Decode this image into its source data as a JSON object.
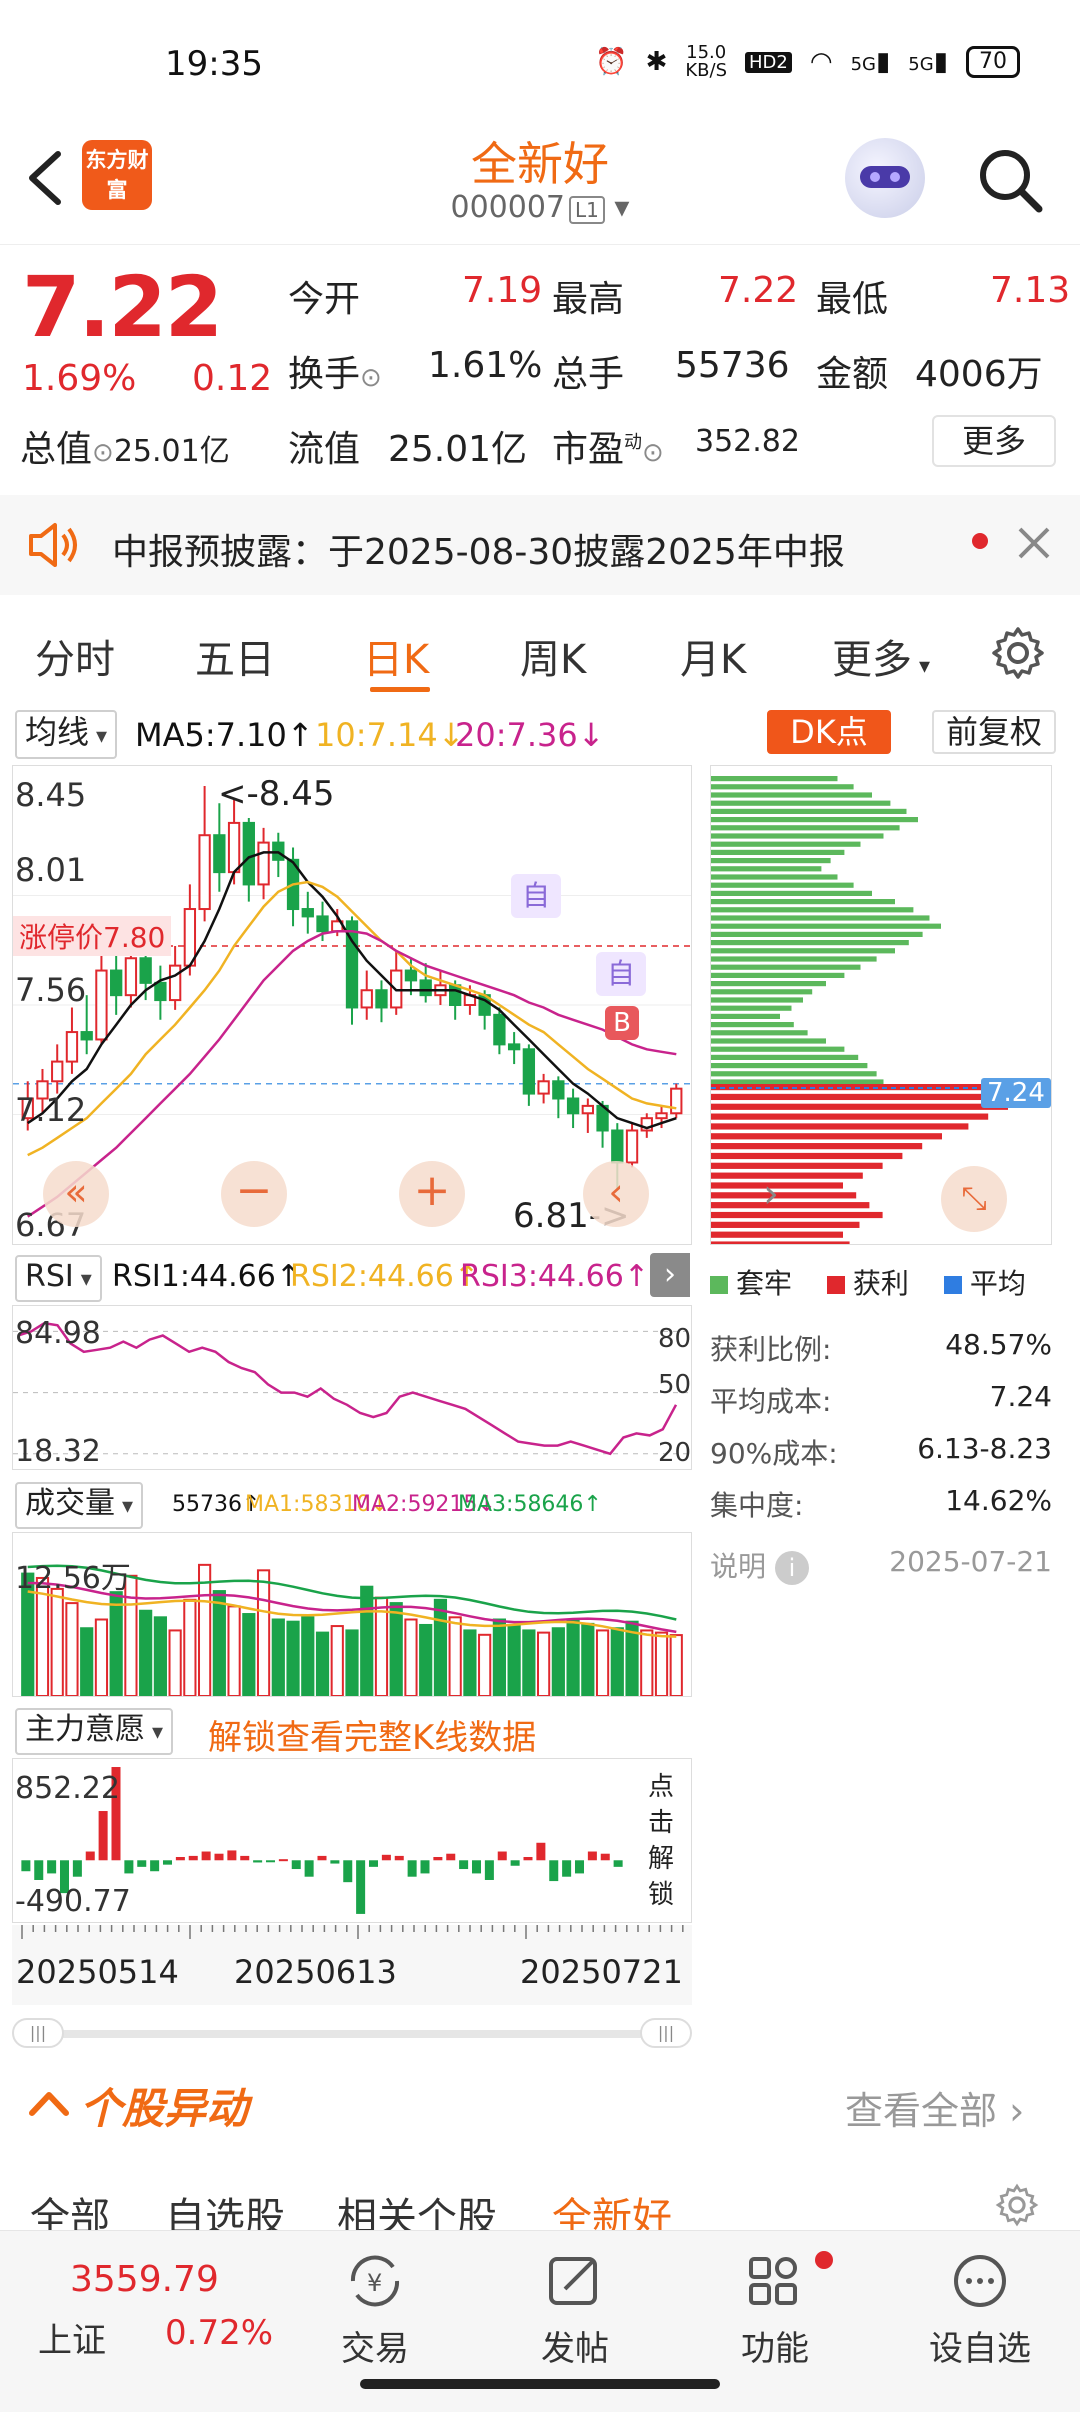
{
  "status": {
    "time": "19:35",
    "net_speed": "15.0",
    "net_unit": "KB/S",
    "hd": "HD2",
    "sig1": "5G",
    "sig2": "5G",
    "battery": "70"
  },
  "header": {
    "logo_text": "东方财富",
    "stock_name": "全新好",
    "stock_code": "000007",
    "level": "L1"
  },
  "quote": {
    "price": "7.22",
    "change_pct": "1.69%",
    "change": "0.12",
    "open_label": "今开",
    "open": "7.19",
    "high_label": "最高",
    "high": "7.22",
    "low_label": "最低",
    "low": "7.13",
    "turnover_label": "换手",
    "turnover": "1.61%",
    "volume_label": "总手",
    "volume": "55736",
    "amount_label": "金额",
    "amount": "4006万",
    "mcap_label": "总值",
    "mcap": "25.01亿",
    "float_label": "流值",
    "float": "25.01亿",
    "pe_label": "市盈",
    "pe_sup": "动",
    "pe": "352.82",
    "more_label": "更多"
  },
  "notice": {
    "text": "中报预披露：于2025-08-30披露2025年中报"
  },
  "tabs": [
    "分时",
    "五日",
    "日K",
    "周K",
    "月K",
    "更多"
  ],
  "active_tab": "日K",
  "ma": {
    "select": "均线",
    "ma5": "MA5:7.10",
    "ma10": "10:7.14",
    "ma20": "20:7.36",
    "dk": "DK点",
    "adjust": "前复权"
  },
  "kline_axis": {
    "y1": "8.45",
    "y2": "8.01",
    "y3": "7.56",
    "y4": "7.12",
    "y5": "6.67",
    "limit_label": "涨停价7.80",
    "high_mark": "<-8.45",
    "low_mark": "6.81->",
    "mark_self": "自",
    "mark_b": "B"
  },
  "chart_data": {
    "type": "candlestick",
    "ylim": [
      6.67,
      8.45
    ],
    "last_label": "7.24",
    "candles": [
      {
        "o": 7.1,
        "c": 7.18,
        "h": 7.25,
        "l": 7.05
      },
      {
        "o": 7.18,
        "c": 7.25,
        "h": 7.3,
        "l": 7.12
      },
      {
        "o": 7.25,
        "c": 7.33,
        "h": 7.4,
        "l": 7.2
      },
      {
        "o": 7.33,
        "c": 7.45,
        "h": 7.55,
        "l": 7.28
      },
      {
        "o": 7.45,
        "c": 7.42,
        "h": 7.6,
        "l": 7.36
      },
      {
        "o": 7.42,
        "c": 7.7,
        "h": 7.82,
        "l": 7.4
      },
      {
        "o": 7.7,
        "c": 7.6,
        "h": 7.8,
        "l": 7.52
      },
      {
        "o": 7.6,
        "c": 7.75,
        "h": 7.85,
        "l": 7.55
      },
      {
        "o": 7.75,
        "c": 7.65,
        "h": 7.82,
        "l": 7.58
      },
      {
        "o": 7.65,
        "c": 7.58,
        "h": 7.72,
        "l": 7.5
      },
      {
        "o": 7.58,
        "c": 7.72,
        "h": 7.8,
        "l": 7.54
      },
      {
        "o": 7.72,
        "c": 7.95,
        "h": 8.05,
        "l": 7.68
      },
      {
        "o": 7.95,
        "c": 8.25,
        "h": 8.45,
        "l": 7.9
      },
      {
        "o": 8.25,
        "c": 8.1,
        "h": 8.38,
        "l": 8.02
      },
      {
        "o": 8.1,
        "c": 8.3,
        "h": 8.4,
        "l": 8.05
      },
      {
        "o": 8.3,
        "c": 8.05,
        "h": 8.32,
        "l": 7.98
      },
      {
        "o": 8.05,
        "c": 8.22,
        "h": 8.28,
        "l": 7.99
      },
      {
        "o": 8.22,
        "c": 8.15,
        "h": 8.26,
        "l": 8.08
      },
      {
        "o": 8.15,
        "c": 7.95,
        "h": 8.2,
        "l": 7.88
      },
      {
        "o": 7.95,
        "c": 7.92,
        "h": 8.02,
        "l": 7.85
      },
      {
        "o": 7.92,
        "c": 7.86,
        "h": 7.98,
        "l": 7.82
      },
      {
        "o": 7.86,
        "c": 7.9,
        "h": 7.95,
        "l": 7.84
      },
      {
        "o": 7.9,
        "c": 7.55,
        "h": 7.92,
        "l": 7.48
      },
      {
        "o": 7.55,
        "c": 7.62,
        "h": 7.7,
        "l": 7.5
      },
      {
        "o": 7.62,
        "c": 7.55,
        "h": 7.66,
        "l": 7.49
      },
      {
        "o": 7.55,
        "c": 7.7,
        "h": 7.78,
        "l": 7.52
      },
      {
        "o": 7.7,
        "c": 7.66,
        "h": 7.75,
        "l": 7.6
      },
      {
        "o": 7.66,
        "c": 7.6,
        "h": 7.73,
        "l": 7.57
      },
      {
        "o": 7.6,
        "c": 7.64,
        "h": 7.7,
        "l": 7.56
      },
      {
        "o": 7.64,
        "c": 7.56,
        "h": 7.66,
        "l": 7.5
      },
      {
        "o": 7.56,
        "c": 7.6,
        "h": 7.64,
        "l": 7.52
      },
      {
        "o": 7.6,
        "c": 7.52,
        "h": 7.62,
        "l": 7.46
      },
      {
        "o": 7.52,
        "c": 7.4,
        "h": 7.55,
        "l": 7.36
      },
      {
        "o": 7.4,
        "c": 7.38,
        "h": 7.45,
        "l": 7.32
      },
      {
        "o": 7.38,
        "c": 7.2,
        "h": 7.4,
        "l": 7.15
      },
      {
        "o": 7.2,
        "c": 7.25,
        "h": 7.28,
        "l": 7.16
      },
      {
        "o": 7.25,
        "c": 7.18,
        "h": 7.27,
        "l": 7.1
      },
      {
        "o": 7.18,
        "c": 7.12,
        "h": 7.22,
        "l": 7.06
      },
      {
        "o": 7.12,
        "c": 7.15,
        "h": 7.18,
        "l": 7.04
      },
      {
        "o": 7.15,
        "c": 7.05,
        "h": 7.17,
        "l": 6.98
      },
      {
        "o": 7.05,
        "c": 6.92,
        "h": 7.08,
        "l": 6.81
      },
      {
        "o": 6.92,
        "c": 7.05,
        "h": 7.08,
        "l": 6.9
      },
      {
        "o": 7.05,
        "c": 7.1,
        "h": 7.12,
        "l": 7.02
      },
      {
        "o": 7.1,
        "c": 7.12,
        "h": 7.15,
        "l": 7.06
      },
      {
        "o": 7.12,
        "c": 7.22,
        "h": 7.24,
        "l": 7.1
      }
    ],
    "ma5": [
      7.08,
      7.12,
      7.18,
      7.25,
      7.3,
      7.4,
      7.48,
      7.56,
      7.62,
      7.66,
      7.68,
      7.72,
      7.82,
      7.95,
      8.1,
      8.16,
      8.18,
      8.18,
      8.14,
      8.06,
      8.0,
      7.92,
      7.82,
      7.74,
      7.68,
      7.62,
      7.62,
      7.62,
      7.62,
      7.62,
      7.6,
      7.58,
      7.54,
      7.48,
      7.42,
      7.36,
      7.3,
      7.24,
      7.2,
      7.15,
      7.1,
      7.08,
      7.06,
      7.08,
      7.1
    ],
    "ma10": [
      6.95,
      6.98,
      7.02,
      7.06,
      7.1,
      7.16,
      7.22,
      7.28,
      7.36,
      7.42,
      7.48,
      7.55,
      7.62,
      7.7,
      7.8,
      7.88,
      7.96,
      8.02,
      8.05,
      8.06,
      8.04,
      8.0,
      7.94,
      7.88,
      7.82,
      7.78,
      7.72,
      7.68,
      7.66,
      7.64,
      7.62,
      7.6,
      7.56,
      7.52,
      7.48,
      7.45,
      7.4,
      7.35,
      7.3,
      7.26,
      7.22,
      7.18,
      7.16,
      7.15,
      7.14
    ],
    "ma20": [
      6.7,
      6.74,
      6.78,
      6.83,
      6.88,
      6.93,
      6.98,
      7.04,
      7.1,
      7.16,
      7.22,
      7.28,
      7.35,
      7.42,
      7.5,
      7.58,
      7.66,
      7.72,
      7.78,
      7.82,
      7.85,
      7.86,
      7.86,
      7.85,
      7.82,
      7.78,
      7.75,
      7.72,
      7.7,
      7.68,
      7.66,
      7.64,
      7.62,
      7.6,
      7.57,
      7.55,
      7.52,
      7.5,
      7.48,
      7.46,
      7.43,
      7.4,
      7.38,
      7.37,
      7.36
    ],
    "rsi_ylim": [
      18.32,
      84.98
    ],
    "rsi": [
      78,
      80,
      84,
      83,
      74,
      70,
      71,
      72,
      75,
      72,
      76,
      78,
      74,
      70,
      72,
      70,
      65,
      62,
      60,
      54,
      50,
      50,
      48,
      52,
      47,
      44,
      40,
      38,
      40,
      48,
      50,
      48,
      46,
      44,
      42,
      38,
      34,
      30,
      26,
      25,
      24,
      24,
      26,
      24,
      22,
      20,
      28,
      30,
      29,
      32,
      44
    ],
    "volume_ylim": [
      0,
      140000
    ],
    "volume": [
      112000,
      108000,
      98000,
      85000,
      62000,
      70000,
      95000,
      110000,
      78000,
      72000,
      60000,
      88000,
      120000,
      96000,
      82000,
      75000,
      115000,
      70000,
      68000,
      72000,
      58000,
      64000,
      60000,
      100000,
      90000,
      85000,
      70000,
      65000,
      88000,
      72000,
      60000,
      56000,
      70000,
      65000,
      60000,
      58000,
      62000,
      70000,
      66000,
      60000,
      62000,
      68000,
      60000,
      58000,
      55736
    ],
    "vol_up": [
      0,
      1,
      1,
      1,
      0,
      1,
      0,
      1,
      0,
      0,
      1,
      1,
      1,
      0,
      1,
      0,
      1,
      0,
      0,
      0,
      0,
      1,
      0,
      0,
      1,
      0,
      1,
      0,
      0,
      1,
      0,
      1,
      0,
      0,
      0,
      1,
      0,
      0,
      0,
      1,
      0,
      0,
      1,
      1,
      1
    ],
    "flow_ylim": [
      -490.77,
      852.22
    ],
    "flow": [
      -100,
      -180,
      -120,
      -300,
      -150,
      80,
      450,
      852,
      -120,
      -60,
      -100,
      -40,
      30,
      40,
      80,
      60,
      90,
      40,
      -20,
      -10,
      10,
      -80,
      -150,
      40,
      -30,
      -200,
      -490,
      -60,
      50,
      40,
      -150,
      -120,
      30,
      60,
      -80,
      -120,
      -180,
      80,
      -50,
      30,
      160,
      -190,
      -150,
      -120,
      80,
      60,
      -60
    ]
  },
  "rsi": {
    "select": "RSI",
    "rsi1": "RSI1:44.66",
    "rsi2": "RSI2:44.66",
    "rsi3": "RSI3:44.66",
    "y_top": "84.98",
    "y_bot": "18.32",
    "l80": "80",
    "l50": "50",
    "l20": "20"
  },
  "vol": {
    "select": "成交量",
    "v": "55736",
    "ma1": "MA1:58310",
    "ma2": "MA2:59215",
    "ma3": "MA3:58646",
    "y_top": "12.56万"
  },
  "flow": {
    "select": "主力意愿",
    "unlock": "解锁查看完整K线数据",
    "y_top": "852.22",
    "y_bot": "-490.77",
    "side": [
      "点",
      "击",
      "解",
      "锁"
    ]
  },
  "dates": [
    "20250514",
    "20250613",
    "20250721"
  ],
  "chips": {
    "legend": [
      "套牢",
      "获利",
      "平均"
    ],
    "rows": [
      {
        "label": "获利比例:",
        "value": "48.57%"
      },
      {
        "label": "平均成本:",
        "value": "7.24"
      },
      {
        "label": "90%成本:",
        "value": "6.13-8.23"
      },
      {
        "label": "集中度:",
        "value": "14.62%"
      }
    ],
    "note": "说明",
    "date": "2025-07-21",
    "bars_green": [
      0.55,
      0.62,
      0.7,
      0.78,
      0.85,
      0.9,
      0.82,
      0.75,
      0.65,
      0.58,
      0.52,
      0.48,
      0.55,
      0.62,
      0.7,
      0.8,
      0.88,
      0.95,
      1.0,
      0.92,
      0.86,
      0.8,
      0.72,
      0.65,
      0.58,
      0.5,
      0.44,
      0.4,
      0.35,
      0.3,
      0.36,
      0.42,
      0.5,
      0.58,
      0.64,
      0.68,
      0.72,
      0.75
    ],
    "bars_red": [
      1.0,
      0.96,
      0.9,
      0.84,
      0.78,
      0.7,
      0.64,
      0.58,
      0.52,
      0.46,
      0.4,
      0.44,
      0.48,
      0.52,
      0.45,
      0.4,
      0.42,
      0.38,
      0.34,
      0.3,
      0.26,
      0.22,
      0.18,
      0.14
    ]
  },
  "section": {
    "title": "个股异动",
    "view_all": "查看全部",
    "subtabs": [
      "全部",
      "自选股",
      "相关个股",
      "全新好"
    ]
  },
  "bottom": {
    "index_value": "3559.79",
    "index_name": "上证",
    "index_pct": "0.72%",
    "items": [
      "交易",
      "发帖",
      "功能",
      "设自选"
    ]
  },
  "colors": {
    "up": "#e0282d",
    "down": "#1aa34a",
    "accent": "#f06a14",
    "ma5": "#111111",
    "ma10": "#f0b323",
    "ma20": "#c8238c"
  }
}
